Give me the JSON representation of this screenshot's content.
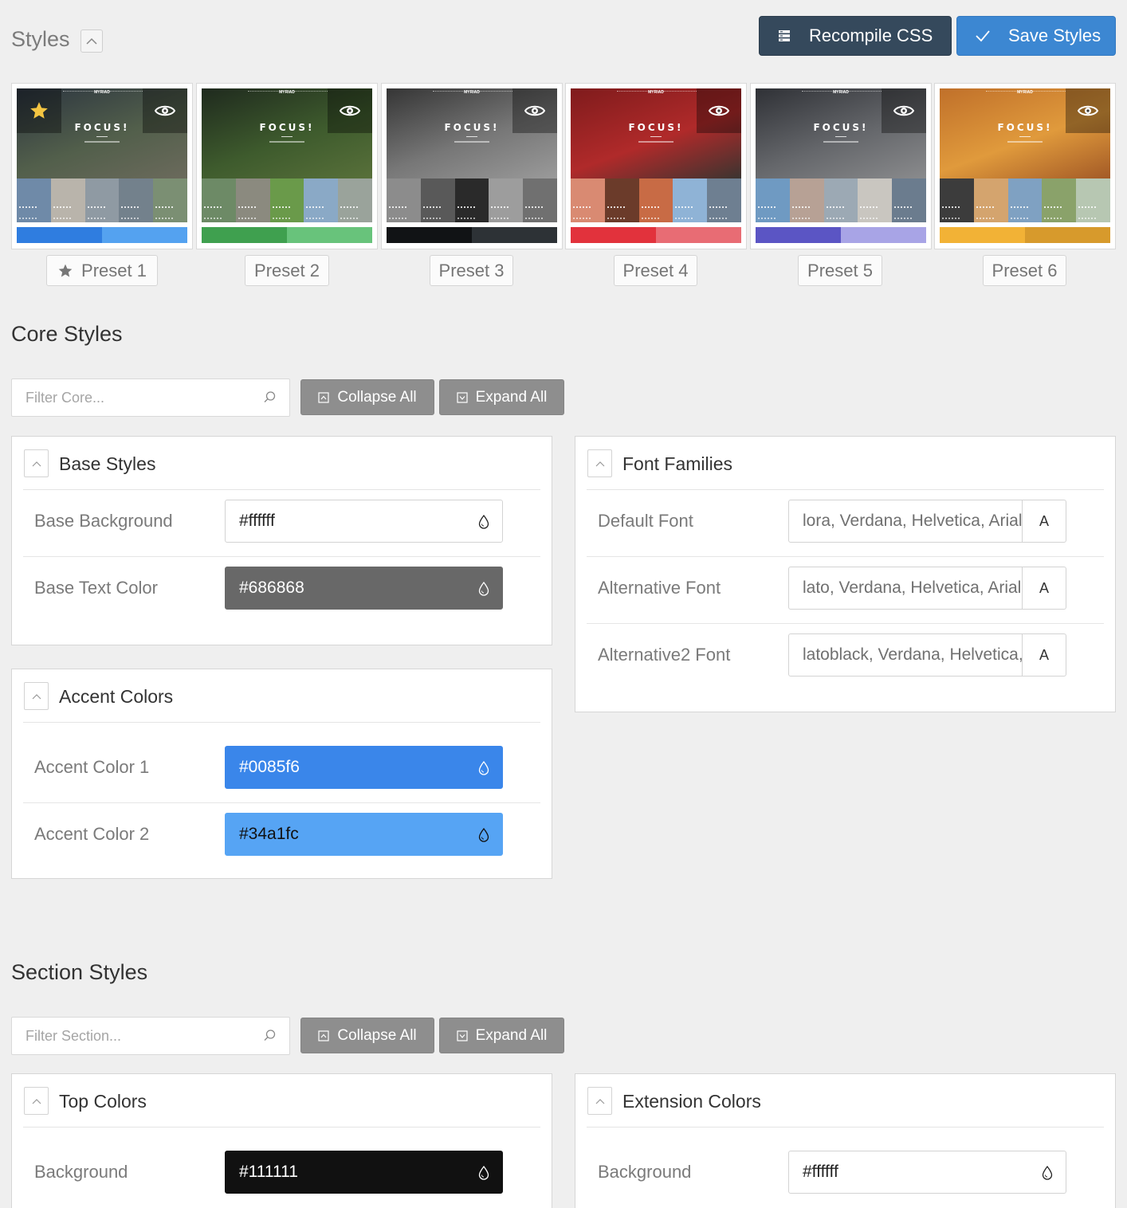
{
  "header": {
    "title": "Styles",
    "recompile_label": "Recompile CSS",
    "save_label": "Save Styles"
  },
  "presets": [
    {
      "label": "Preset 1",
      "thumb_logo": "MYRIAD",
      "thumb_title": "FOCUS!",
      "swatch_colors": [
        "#2f7de0",
        "#54a2f0"
      ],
      "hero_colors": [
        "#2c3540",
        "#525f4b",
        "#6b6a5c"
      ],
      "tile_colors": [
        "#6f8aa8",
        "#b9b4ab",
        "#8f9aa3",
        "#73818c",
        "#7b8f73"
      ],
      "active": true
    },
    {
      "label": "Preset 2",
      "thumb_logo": "MYRIAD",
      "thumb_title": "FOCUS!",
      "swatch_colors": [
        "#3fa04f",
        "#68c37b"
      ],
      "hero_colors": [
        "#1f2a1e",
        "#3e5b2d",
        "#58703a"
      ],
      "tile_colors": [
        "#6d8a66",
        "#8b8a7f",
        "#6a9a4a",
        "#8aa9c6",
        "#9aa39b"
      ],
      "active": false
    },
    {
      "label": "Preset 3",
      "thumb_logo": "MYRIAD",
      "thumb_title": "FOCUS!",
      "swatch_colors": [
        "#111315",
        "#2d3236"
      ],
      "hero_colors": [
        "#353535",
        "#777777",
        "#9a9a9a"
      ],
      "tile_colors": [
        "#8c8c8c",
        "#595959",
        "#2a2a2a",
        "#9d9d9d",
        "#707070"
      ],
      "active": false
    },
    {
      "label": "Preset 4",
      "thumb_logo": "MYRIAD",
      "thumb_title": "FOCUS!",
      "swatch_colors": [
        "#e2323c",
        "#e86c74"
      ],
      "hero_colors": [
        "#7f1b1c",
        "#b02a2a",
        "#3b3430"
      ],
      "tile_colors": [
        "#d98a72",
        "#6b3b2a",
        "#c86b45",
        "#8fb3d6",
        "#6e7f91"
      ],
      "active": false
    },
    {
      "label": "Preset 5",
      "thumb_logo": "MYRIAD",
      "thumb_title": "FOCUS!",
      "swatch_colors": [
        "#5b55c4",
        "#a8a4e6"
      ],
      "hero_colors": [
        "#2f3136",
        "#65676b",
        "#8a8b8d"
      ],
      "tile_colors": [
        "#6f9ac2",
        "#b7a195",
        "#9ca9b4",
        "#c9c6c0",
        "#6b7c8e"
      ],
      "active": false
    },
    {
      "label": "Preset 6",
      "thumb_logo": "MYRIAD",
      "thumb_title": "FOCUS!",
      "swatch_colors": [
        "#f2b236",
        "#d79a2c"
      ],
      "hero_colors": [
        "#c0702a",
        "#e09a3c",
        "#a35a26"
      ],
      "tile_colors": [
        "#3c3c3c",
        "#d4a46e",
        "#7fa1c2",
        "#8aa26a",
        "#b7c7b2"
      ],
      "active": false
    }
  ],
  "core": {
    "title": "Core Styles",
    "filter_placeholder": "Filter Core...",
    "collapse_label": "Collapse All",
    "expand_label": "Expand All",
    "base_styles": {
      "title": "Base Styles",
      "rows": [
        {
          "label": "Base Background",
          "value": "#ffffff",
          "bg": "#ffffff",
          "fg": "#222222"
        },
        {
          "label": "Base Text Color",
          "value": "#686868",
          "bg": "#686868",
          "fg": "#ffffff"
        }
      ]
    },
    "accent_colors": {
      "title": "Accent Colors",
      "rows": [
        {
          "label": "Accent Color 1",
          "value": "#0085f6",
          "bg": "#3a86ea",
          "fg": "#ffffff"
        },
        {
          "label": "Accent Color 2",
          "value": "#34a1fc",
          "bg": "#56a4f4",
          "fg": "#111111"
        }
      ]
    },
    "font_families": {
      "title": "Font Families",
      "rows": [
        {
          "label": "Default Font",
          "value": "lora, Verdana, Helvetica, Arial, sans-serif",
          "button": "A"
        },
        {
          "label": "Alternative Font",
          "value": "lato, Verdana, Helvetica, Arial, sans-serif",
          "button": "A"
        },
        {
          "label": "Alternative2 Font",
          "value": "latoblack, Verdana, Helvetica, Arial, sans-serif",
          "button": "A"
        }
      ]
    }
  },
  "section": {
    "title": "Section Styles",
    "filter_placeholder": "Filter Section...",
    "collapse_label": "Collapse All",
    "expand_label": "Expand All",
    "top_colors": {
      "title": "Top Colors",
      "rows": [
        {
          "label": "Background",
          "value": "#111111",
          "bg": "#111111",
          "fg": "#ffffff"
        }
      ]
    },
    "extension_colors": {
      "title": "Extension Colors",
      "rows": [
        {
          "label": "Background",
          "value": "#ffffff",
          "bg": "#ffffff",
          "fg": "#222222"
        }
      ]
    }
  }
}
